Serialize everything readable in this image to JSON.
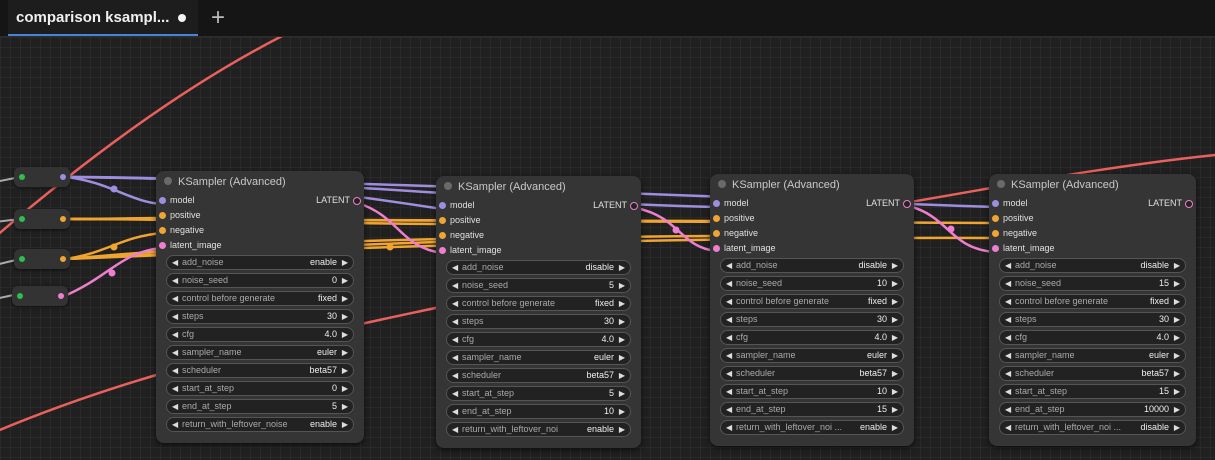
{
  "tab": {
    "title": "comparison ksampl...",
    "add_label": "+"
  },
  "node_titles": [
    "KSampler (Advanced)",
    "KSampler (Advanced)",
    "KSampler (Advanced)",
    "KSampler (Advanced)"
  ],
  "inputs": [
    "model",
    "positive",
    "negative",
    "latent_image"
  ],
  "output_label": "LATENT",
  "widget_names": [
    "add_noise",
    "noise_seed",
    "control before generate",
    "steps",
    "cfg",
    "sampler_name",
    "scheduler",
    "start_at_step",
    "end_at_step",
    "return_with_leftover_noise",
    "return_with_leftover_noi",
    "return_with_leftover_noi ..."
  ],
  "nodes": [
    {
      "add_noise": "enable",
      "noise_seed": "0",
      "control": "fixed",
      "steps": "30",
      "cfg": "4.0",
      "sampler": "euler",
      "scheduler": "beta57",
      "start": "0",
      "end": "5",
      "leftover_name": "return_with_leftover_noise",
      "leftover": "enable"
    },
    {
      "add_noise": "disable",
      "noise_seed": "5",
      "control": "fixed",
      "steps": "30",
      "cfg": "4.0",
      "sampler": "euler",
      "scheduler": "beta57",
      "start": "5",
      "end": "10",
      "leftover_name": "return_with_leftover_noi",
      "leftover": "enable"
    },
    {
      "add_noise": "disable",
      "noise_seed": "10",
      "control": "fixed",
      "steps": "30",
      "cfg": "4.0",
      "sampler": "euler",
      "scheduler": "beta57",
      "start": "10",
      "end": "15",
      "leftover_name": "return_with_leftover_noi ...",
      "leftover": "enable"
    },
    {
      "add_noise": "disable",
      "noise_seed": "15",
      "control": "fixed",
      "steps": "30",
      "cfg": "4.0",
      "sampler": "euler",
      "scheduler": "beta57",
      "start": "15",
      "end": "10000",
      "leftover_name": "return_with_leftover_noi ...",
      "leftover": "disable"
    }
  ],
  "colors": {
    "model": "#9f8ee0",
    "conditioning": "#f0a431",
    "latent": "#ee7fce",
    "vae": "#e9605d",
    "reroute_in": "#2ec04f"
  }
}
